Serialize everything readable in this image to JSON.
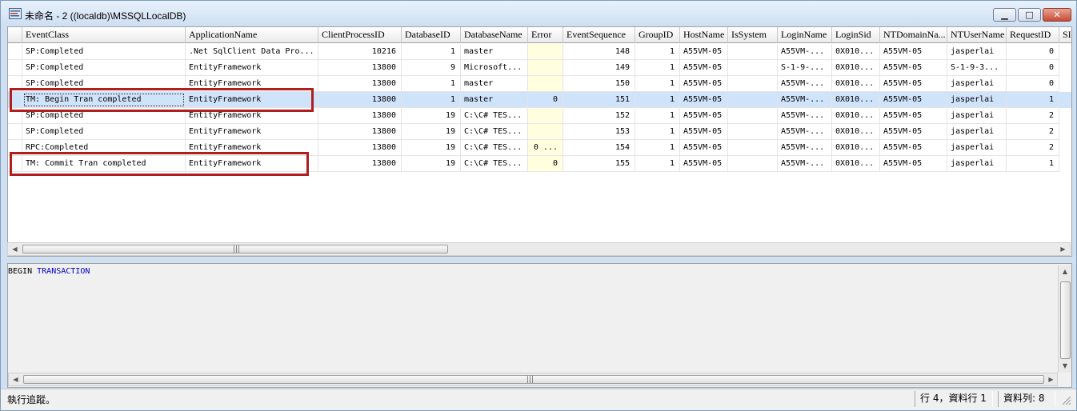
{
  "window": {
    "title": "未命名 - 2 ((localdb)\\MSSQLLocalDB)"
  },
  "columns": [
    "",
    "EventClass",
    "ApplicationName",
    "ClientProcessID",
    "DatabaseID",
    "DatabaseName",
    "Error",
    "EventSequence",
    "GroupID",
    "HostName",
    "IsSystem",
    "LoginName",
    "LoginSid",
    "NTDomainNa...",
    "NTUserName",
    "RequestID",
    "SI"
  ],
  "rows": [
    [
      "SP:Completed",
      ".Net SqlClient Data Pro...",
      "10216",
      "1",
      "master",
      "",
      "148",
      "1",
      "A55VM-05",
      "",
      "A55VM-...",
      "0X010...",
      "A55VM-05",
      "jasperlai",
      "0"
    ],
    [
      "SP:Completed",
      "EntityFramework",
      "13800",
      "9",
      "Microsoft...",
      "",
      "149",
      "1",
      "A55VM-05",
      "",
      "S-1-9-...",
      "0X010...",
      "A55VM-05",
      "S-1-9-3...",
      "0"
    ],
    [
      "SP:Completed",
      "EntityFramework",
      "13800",
      "1",
      "master",
      "",
      "150",
      "1",
      "A55VM-05",
      "",
      "A55VM-...",
      "0X010...",
      "A55VM-05",
      "jasperlai",
      "0"
    ],
    [
      "TM: Begin Tran completed",
      "EntityFramework",
      "13800",
      "1",
      "master",
      "0",
      "151",
      "1",
      "A55VM-05",
      "",
      "A55VM-...",
      "0X010...",
      "A55VM-05",
      "jasperlai",
      "1"
    ],
    [
      "SP:Completed",
      "EntityFramework",
      "13800",
      "19",
      "C:\\C# TES...",
      "",
      "152",
      "1",
      "A55VM-05",
      "",
      "A55VM-...",
      "0X010...",
      "A55VM-05",
      "jasperlai",
      "2"
    ],
    [
      "SP:Completed",
      "EntityFramework",
      "13800",
      "19",
      "C:\\C# TES...",
      "",
      "153",
      "1",
      "A55VM-05",
      "",
      "A55VM-...",
      "0X010...",
      "A55VM-05",
      "jasperlai",
      "2"
    ],
    [
      "RPC:Completed",
      "EntityFramework",
      "13800",
      "19",
      "C:\\C# TES...",
      "0 ...",
      "154",
      "1",
      "A55VM-05",
      "",
      "A55VM-...",
      "0X010...",
      "A55VM-05",
      "jasperlai",
      "2"
    ],
    [
      "TM: Commit Tran completed",
      "EntityFramework",
      "13800",
      "19",
      "C:\\C# TES...",
      "0",
      "155",
      "1",
      "A55VM-05",
      "",
      "A55VM-...",
      "0X010...",
      "A55VM-05",
      "jasperlai",
      "1"
    ]
  ],
  "selected_row_index": 3,
  "highlighted_row_indices": [
    3,
    7
  ],
  "sql_text": {
    "keyword1": "BEGIN",
    "keyword2": "TRANSACTION"
  },
  "status": {
    "main": "執行追蹤。",
    "position": "行 4，資料行 1",
    "rows": "資料列: 8"
  },
  "colors": {
    "selection": "#cfe3fb",
    "highlight_box": "#b01e1e",
    "keyword": "#0000c8"
  }
}
